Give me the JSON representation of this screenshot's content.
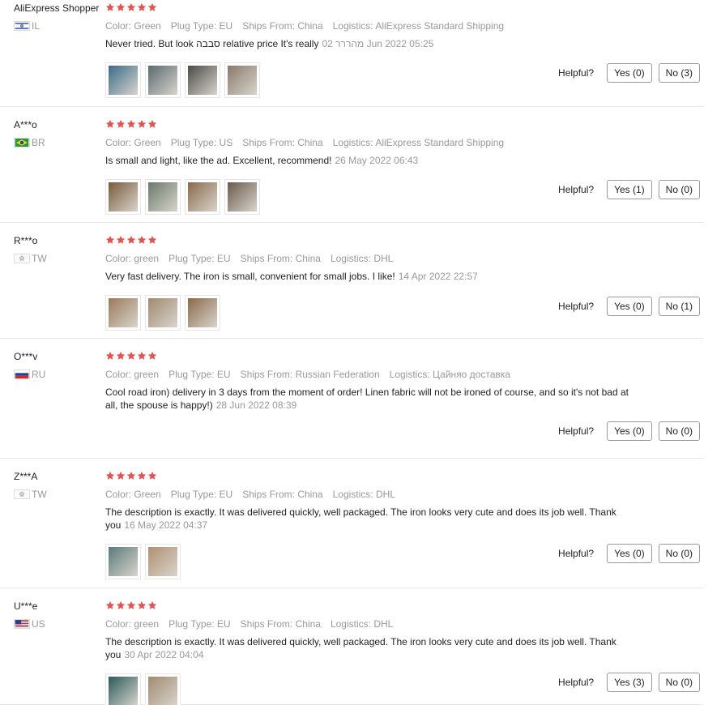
{
  "helpful_label": "Helpful?",
  "reviews": [
    {
      "user": "AliExpress Shopper",
      "country": "IL",
      "stars": 5,
      "attrs": [
        {
          "key": "Color:",
          "value": "Green"
        },
        {
          "key": "Plug Type:",
          "value": "EU"
        },
        {
          "key": "Ships From:",
          "value": "China"
        },
        {
          "key": "Logistics:",
          "value": "AliExpress Standard Shipping"
        }
      ],
      "text": "Never tried. But look סבבה relative price It's really",
      "date": "02 מהררר Jun 2022 05:25",
      "photos": [
        "#3a6b8a",
        "#5a6a70",
        "#4a4a45",
        "#8a7a6a"
      ],
      "yes": "Yes (0)",
      "no": "No (3)"
    },
    {
      "user": "A***o",
      "country": "BR",
      "stars": 5,
      "attrs": [
        {
          "key": "Color:",
          "value": "Green"
        },
        {
          "key": "Plug Type:",
          "value": "US"
        },
        {
          "key": "Ships From:",
          "value": "China"
        },
        {
          "key": "Logistics:",
          "value": "AliExpress Standard Shipping"
        }
      ],
      "text": "Is small and light, like the ad. Excellent, recommend!",
      "date": "26 May 2022 06:43",
      "photos": [
        "#7a5a3a",
        "#6a7a6a",
        "#8a6a4a",
        "#6a5a4a"
      ],
      "yes": "Yes (1)",
      "no": "No (0)"
    },
    {
      "user": "R***o",
      "country": "TW",
      "stars": 5,
      "attrs": [
        {
          "key": "Color:",
          "value": "green"
        },
        {
          "key": "Plug Type:",
          "value": "EU"
        },
        {
          "key": "Ships From:",
          "value": "China"
        },
        {
          "key": "Logistics:",
          "value": "DHL"
        }
      ],
      "text": "Very fast delivery. The iron is small, convenient for small jobs. I like!",
      "date": "14 Apr 2022 22:57",
      "photos": [
        "#9a7a5a",
        "#a08a70",
        "#8a6a4a"
      ],
      "yes": "Yes (0)",
      "no": "No (1)"
    },
    {
      "user": "O***v",
      "country": "RU",
      "stars": 5,
      "attrs": [
        {
          "key": "Color:",
          "value": "green"
        },
        {
          "key": "Plug Type:",
          "value": "EU"
        },
        {
          "key": "Ships From:",
          "value": "Russian Federation"
        },
        {
          "key": "Logistics:",
          "value": "Цайняо доставка"
        }
      ],
      "text": "Cool road iron) delivery in 3 days from the moment of order! Linen fabric will not be ironed of course, and so it's not bad at all, the spouse is happy!)",
      "date": "28 Jun 2022 08:39",
      "photos": [],
      "yes": "Yes (0)",
      "no": "No (0)"
    },
    {
      "user": "Z***A",
      "country": "TW",
      "stars": 5,
      "attrs": [
        {
          "key": "Color:",
          "value": "Green"
        },
        {
          "key": "Plug Type:",
          "value": "EU"
        },
        {
          "key": "Ships From:",
          "value": "China"
        },
        {
          "key": "Logistics:",
          "value": "DHL"
        }
      ],
      "text": "The description is exactly. It was delivered quickly, well packaged. The iron looks very cute and does its job well. Thank you",
      "date": "16 May 2022 04:37",
      "photos": [
        "#5a7a7a",
        "#b09070"
      ],
      "yes": "Yes (0)",
      "no": "No (0)"
    },
    {
      "user": "U***e",
      "country": "US",
      "stars": 5,
      "attrs": [
        {
          "key": "Color:",
          "value": "green"
        },
        {
          "key": "Plug Type:",
          "value": "EU"
        },
        {
          "key": "Ships From:",
          "value": "China"
        },
        {
          "key": "Logistics:",
          "value": "DHL"
        }
      ],
      "text": "The description is exactly. It was delivered quickly, well packaged. The iron looks very cute and does its job well. Thank you",
      "date": "30 Apr 2022 04:04",
      "photos": [
        "#2a5a5a",
        "#a08a70"
      ],
      "yes": "Yes (3)",
      "no": "No (0)"
    }
  ],
  "colors": {
    "star": "#e8514f",
    "muted": "#999999",
    "text": "#222222"
  }
}
